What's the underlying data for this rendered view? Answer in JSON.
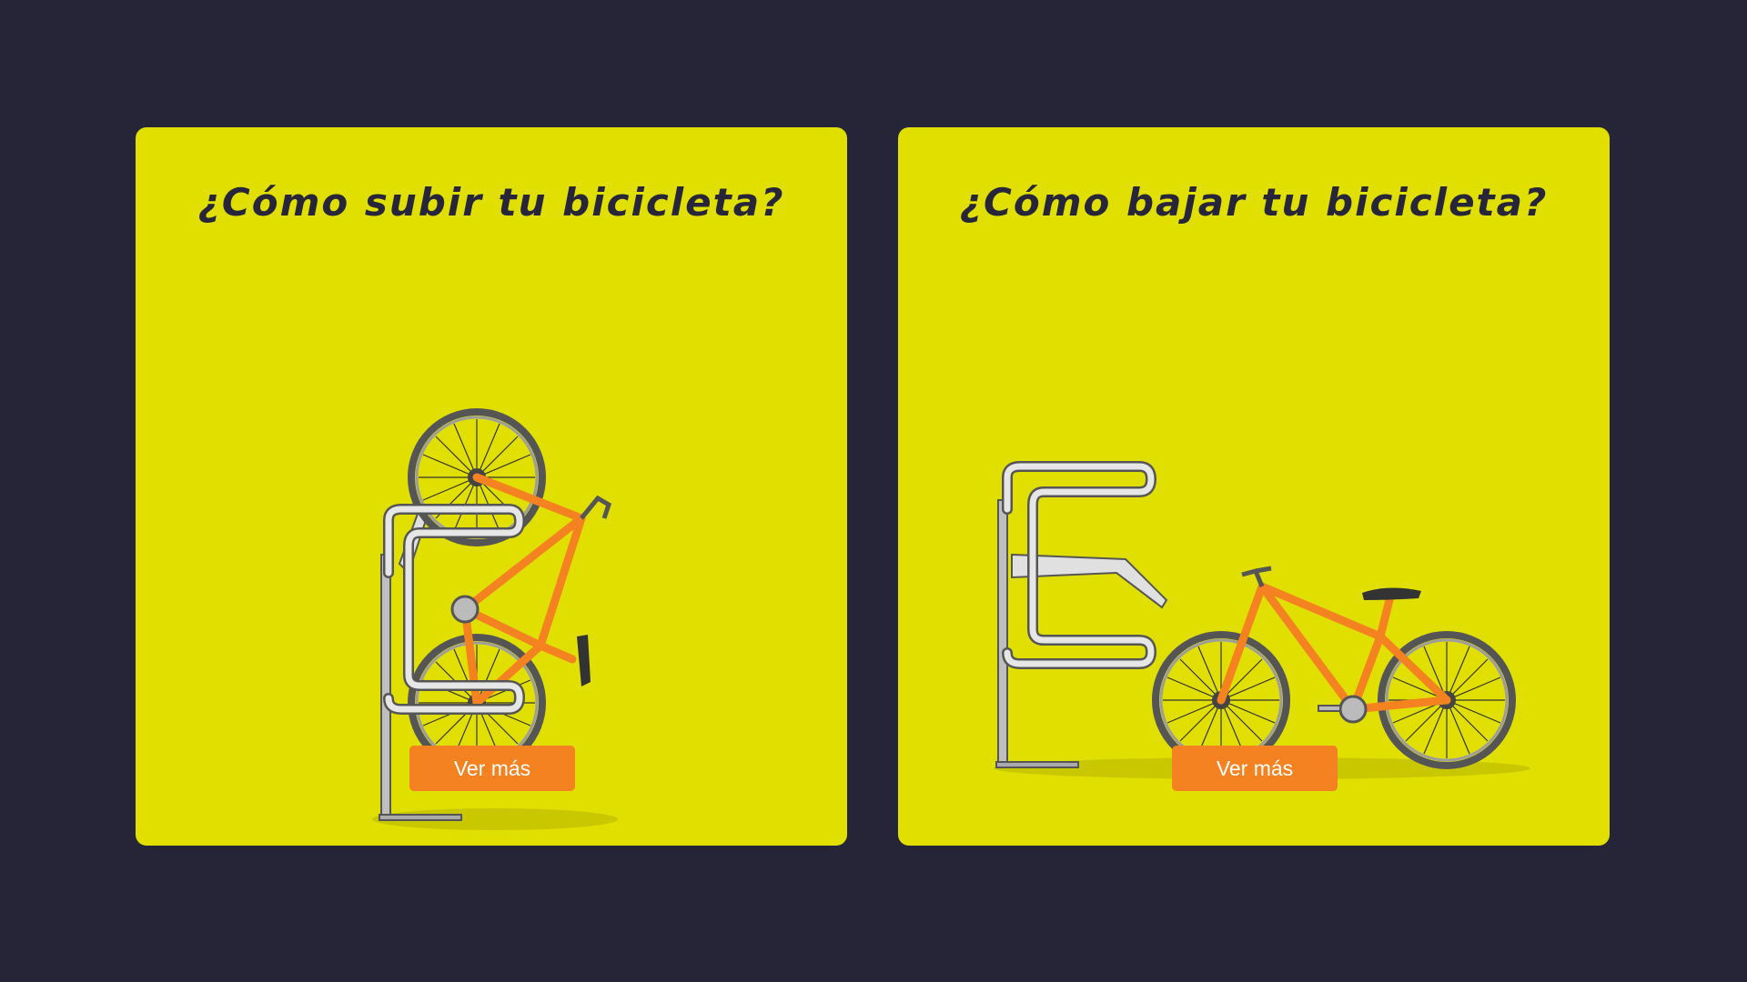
{
  "colors": {
    "background": "#262537",
    "card": "#e0df00",
    "button": "#f58221",
    "title": "#26253a"
  },
  "cards": [
    {
      "title": "¿Cómo subir tu bicicleta?",
      "button_label": "Ver más",
      "illustration": "bike-hanging-vertical-on-rack"
    },
    {
      "title": "¿Cómo bajar tu bicicleta?",
      "button_label": "Ver más",
      "illustration": "bike-standing-beside-rack"
    }
  ]
}
